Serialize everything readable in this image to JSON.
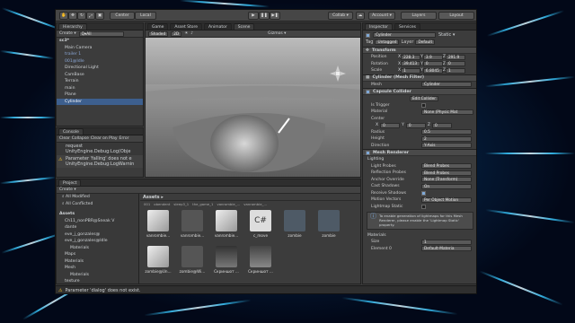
{
  "toolbar": {
    "center_label": "Center",
    "local_label": "Local",
    "collab_label": "Collab ▾",
    "account_label": "Account ▾",
    "layers_label": "Layers",
    "layout_label": "Layout"
  },
  "hierarchy": {
    "tab": "Hierarchy",
    "create": "Create ▾",
    "search_placeholder": "Q▾All",
    "items": [
      "sc3*",
      "Main Camera",
      "trailer 1",
      "001@Idle",
      "Directional Light",
      "CamBase",
      "Terrain",
      "main",
      "Plane",
      "Cylinder"
    ]
  },
  "scene": {
    "tabs": [
      "Game",
      "Asset Store",
      "Animator",
      "Scene"
    ],
    "shading": "Shaded",
    "mode_2d": "2D",
    "gizmos": "Gizmos ▾"
  },
  "console": {
    "tab": "Console",
    "buttons": [
      "Clear",
      "Collapse",
      "Clear on Play",
      "Error"
    ],
    "messages": [
      {
        "title": "request",
        "detail": "UnityEngine.Debug:Log(Obje"
      },
      {
        "title": "Parameter 'falling' does not e",
        "detail": "UnityEngine.Debug:LogWarnin"
      }
    ]
  },
  "project": {
    "tab": "Project",
    "create": "Create ▾",
    "favorites": [
      "All Modified",
      "All Conflicted"
    ],
    "tree": [
      "Assets",
      "Ch11_nonPBR@Sneak V",
      "dante",
      "eve_j_gonzales@",
      "eve_j_gonzales@Idle",
      "Materials",
      "Maps",
      "Materials",
      "Mesh",
      "Materials",
      "texture"
    ],
    "breadcrumb": "Assets ▸",
    "assets_row1": [
      "vanrombie...",
      "vanrombie...",
      "c_move",
      "zombie",
      "zombie"
    ],
    "assets_row1_tops": [
      "001",
      "obendent",
      "sleep3_1",
      "the_game_1",
      "vanrombie_...",
      "vanrombie_..."
    ],
    "assets_row2": [
      "zombie@Un...",
      "zombie@Wi...",
      "Скриншот ...",
      "Скриншот ..."
    ]
  },
  "status": "Parameter 'dialog' does not exist.",
  "inspector": {
    "tab": "Inspector",
    "services_tab": "Services",
    "object_name": "Cylinder",
    "static": "Static ▾",
    "tag_label": "Tag",
    "tag_value": "Untagged",
    "layer_label": "Layer",
    "layer_value": "Default",
    "transform": {
      "title": "Transform",
      "position": {
        "label": "Position",
        "x": "228.3",
        "y": "3.9",
        "z": "291.9"
      },
      "rotation": {
        "label": "Rotation",
        "x": "39.413",
        "y": "0",
        "z": "0"
      },
      "scale": {
        "label": "Scale",
        "x": "1",
        "y": "6.8045",
        "z": "1"
      }
    },
    "mesh_filter": {
      "title": "Cylinder (Mesh Filter)",
      "label": "Mesh",
      "value": "Cylinder"
    },
    "capsule": {
      "title": "Capsule Collider",
      "edit": "Edit Collider",
      "is_trigger": "Is Trigger",
      "material_label": "Material",
      "material_value": "None (Physic Mat",
      "center_label": "Center",
      "cx": "0",
      "cy": "0",
      "cz": "0",
      "radius_label": "Radius",
      "radius": "0.5",
      "height_label": "Height",
      "height": "2",
      "direction_label": "Direction",
      "direction": "Y-Axis"
    },
    "renderer": {
      "title": "Mesh Renderer",
      "lighting": "Lighting",
      "light_probes": "Light Probes",
      "light_probes_val": "Blend Probes",
      "reflection_probes": "Reflection Probes",
      "reflection_probes_val": "Blend Probes",
      "anchor": "Anchor Override",
      "anchor_val": "None (Transform)",
      "cast": "Cast Shadows",
      "cast_val": "On",
      "receive": "Receive Shadows",
      "motion": "Motion Vectors",
      "motion_val": "Per Object Motion",
      "lightmap": "Lightmap Static",
      "note": "To enable generation of lightmaps for this Mesh Renderer, please enable the 'Lightmap Static' property.",
      "materials": "Materials",
      "size_label": "Size",
      "size": "1",
      "elem_label": "Element 0",
      "elem": "Default-Materia"
    }
  },
  "colors": {
    "accent": "#3d5f8e",
    "panel": "#3c3c3c",
    "dark": "#2e2e2e"
  }
}
